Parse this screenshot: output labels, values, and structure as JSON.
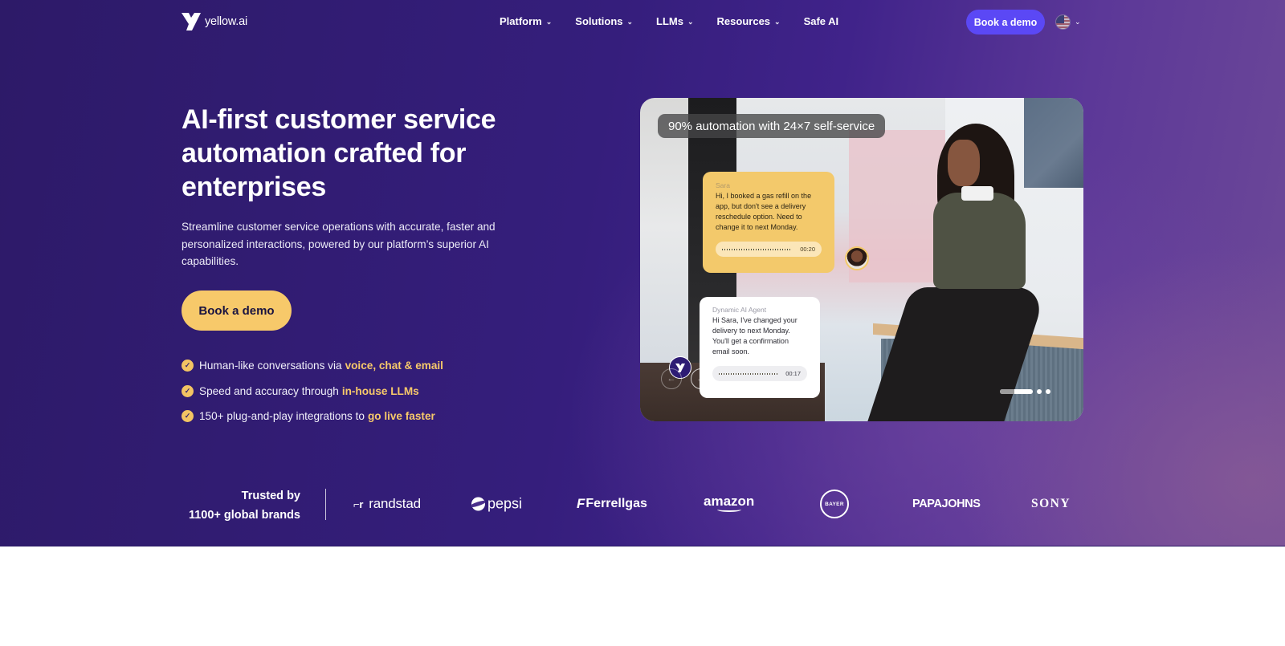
{
  "nav": {
    "logo_text": "yellow.ai",
    "items": [
      {
        "label": "Platform",
        "has_dropdown": true
      },
      {
        "label": "Solutions",
        "has_dropdown": true
      },
      {
        "label": "LLMs",
        "has_dropdown": true
      },
      {
        "label": "Resources",
        "has_dropdown": true
      },
      {
        "label": "Safe AI",
        "has_dropdown": false
      }
    ],
    "cta_label": "Book a demo",
    "language_icon": "us-flag-icon",
    "chevron_glyph": "⌄"
  },
  "hero": {
    "headline": "AI-first customer service automation crafted for enterprises",
    "subtext": "Streamline customer service operations with accurate, faster and personalized interactions, powered by our platform’s superior AI capabilities.",
    "cta_label": "Book a demo",
    "features": [
      {
        "text": "Human-like conversations via",
        "highlight": "voice, chat & email"
      },
      {
        "text": "Speed and accuracy through",
        "highlight": "in-house LLMs"
      },
      {
        "text": "150+ plug-and-play integrations to",
        "highlight": "go live faster"
      }
    ],
    "check_glyph": "✓"
  },
  "media": {
    "banner": "90% automation with 24×7 self-service",
    "user_message": {
      "name": "Sara",
      "text": "Hi, I booked a gas refill on the app, but don't see a delivery reschedule option. Need to change it to next Monday.",
      "duration": "00:20"
    },
    "agent_message": {
      "name": "Dynamic AI Agent",
      "text": "Hi Sara, I've changed your delivery to next Monday. You'll get a confirmation email soon.",
      "duration": "00:17"
    },
    "prev_glyph": "←",
    "next_glyph": "→",
    "carousel": {
      "slides": 3,
      "active_slide": 1,
      "progress": 0.45
    }
  },
  "trusted": {
    "line1": "Trusted by",
    "line2": "1100+ global brands",
    "brands": [
      {
        "name": "randstad",
        "mark": "⌐r"
      },
      {
        "name": "pepsi"
      },
      {
        "name": "Ferrellgas",
        "mark": "F"
      },
      {
        "name": "amazon"
      },
      {
        "name": "BAYER"
      },
      {
        "name": "PAPAJOHNS"
      },
      {
        "name": "SONY"
      }
    ]
  },
  "colors": {
    "brand_purple": "#351e7c",
    "accent_yellow": "#f7c96a",
    "nav_button": "#5b48f5"
  }
}
